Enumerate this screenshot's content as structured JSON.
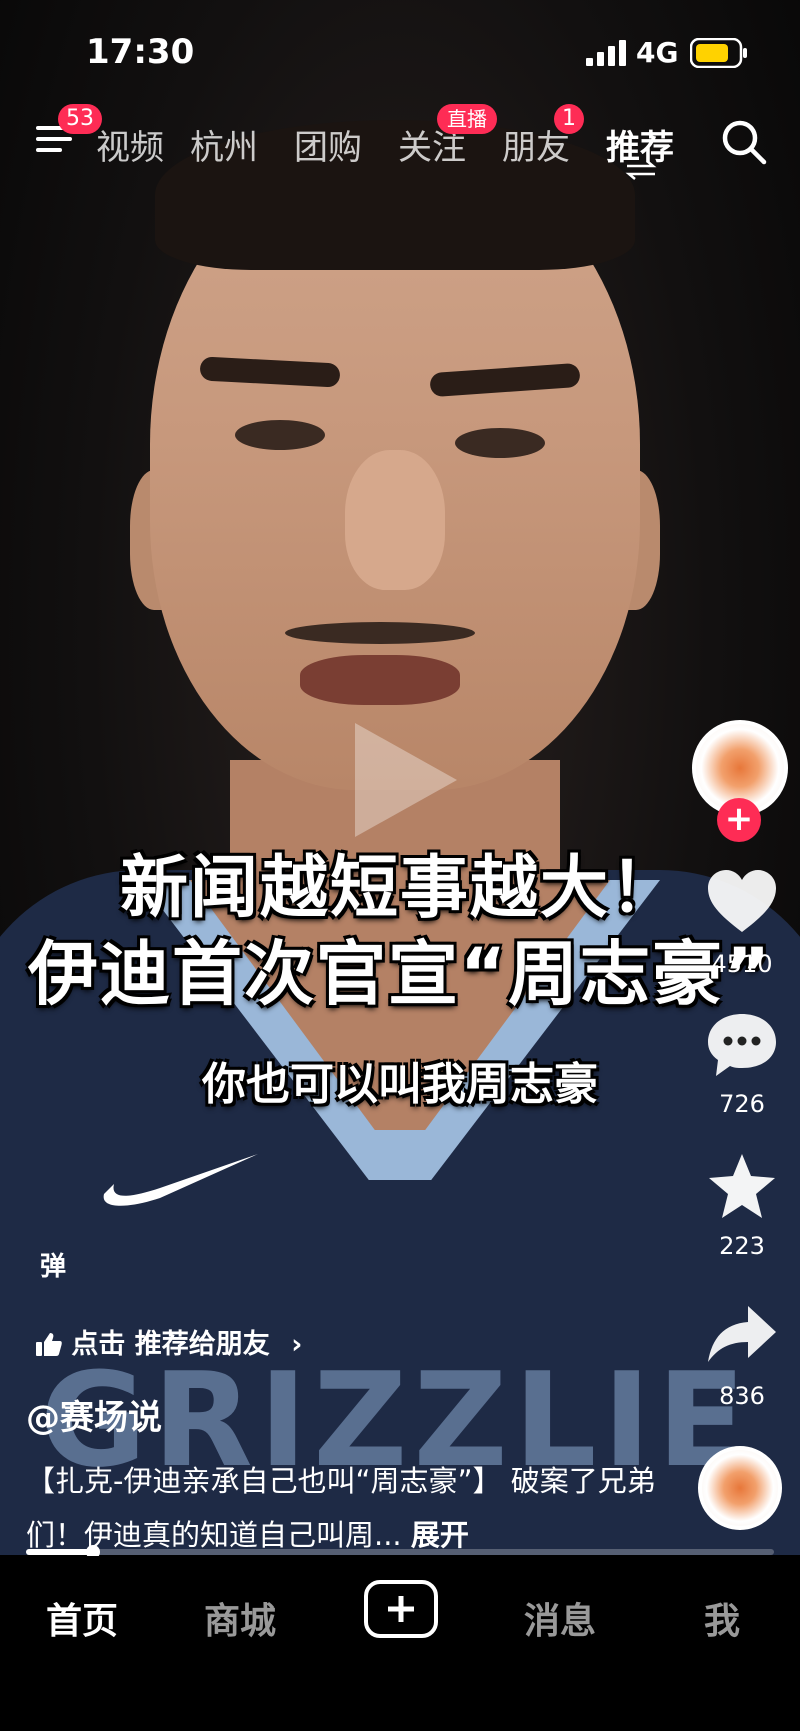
{
  "status_bar": {
    "time": "17:30",
    "network": "4G"
  },
  "top_nav": {
    "menu_badge": "53",
    "tabs": [
      {
        "label": "视频"
      },
      {
        "label": "杭州"
      },
      {
        "label": "团购"
      },
      {
        "label": "关注",
        "badge": "直播"
      },
      {
        "label": "朋友",
        "badge": "1"
      },
      {
        "label": "推荐",
        "active": true
      }
    ]
  },
  "video": {
    "caption_line1": "新闻越短事越大！",
    "caption_line2": "伊迪首次官宣“周志豪”",
    "subtitle": "你也可以叫我周志豪",
    "jersey_text": "GRIZZLIES"
  },
  "sidebar": {
    "likes": "4510",
    "comments": "726",
    "favorites": "223",
    "shares": "836"
  },
  "overlay": {
    "danmu_label": "弹",
    "recommend_text": "点击 推荐给朋友",
    "author": "@赛场说",
    "description": "【扎克-伊迪亲承自己也叫“周志豪”】 破案了兄弟们！伊迪真的知道自己叫周...",
    "expand_label": "展开",
    "progress_fraction": 0.09
  },
  "tab_bar": {
    "home": "首页",
    "mall": "商城",
    "messages": "消息",
    "me": "我"
  },
  "colors": {
    "accent": "#fe2c55",
    "jersey": "#1e2a45",
    "collar": "#9ab7d8"
  },
  "icons": [
    "menu-icon",
    "search-icon",
    "heart-icon",
    "comment-icon",
    "star-icon",
    "share-icon",
    "thumb-up-icon",
    "play-icon",
    "add-icon"
  ]
}
